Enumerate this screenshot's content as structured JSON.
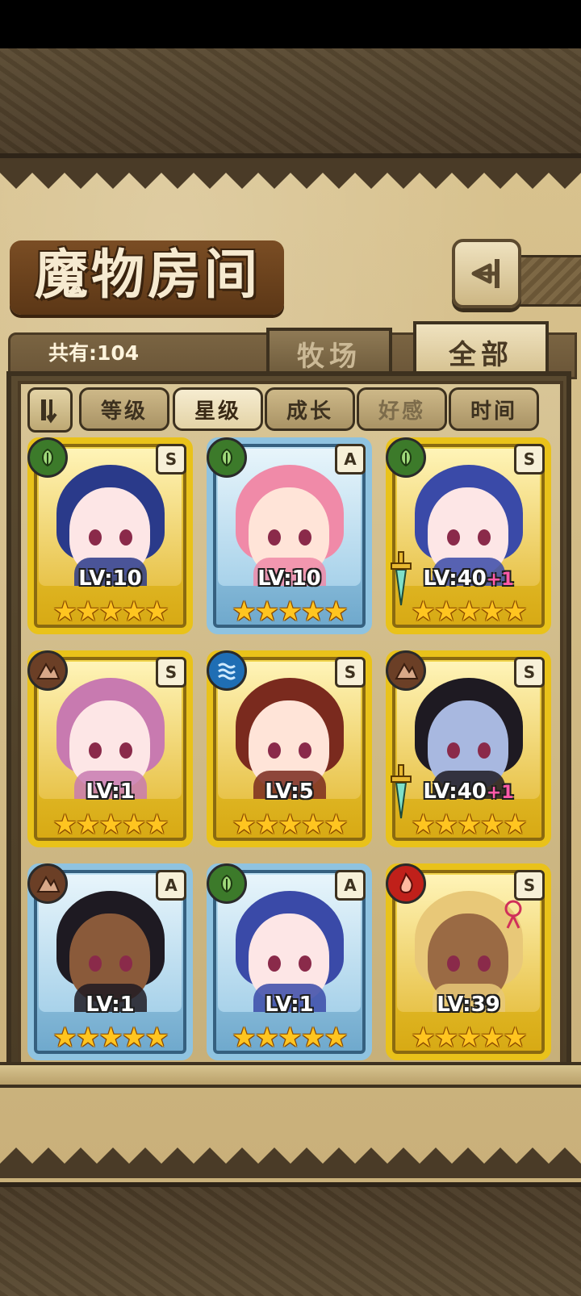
{
  "header": {
    "title": "魔物房间",
    "back_icon": "back-arrow-icon"
  },
  "count": {
    "label": "共有:104"
  },
  "tabs": [
    {
      "label": "牧场",
      "active": false
    },
    {
      "label": "全部",
      "active": true
    }
  ],
  "sort": {
    "toggle_icon": "sort-order-icon",
    "buttons": [
      {
        "label": "等级",
        "state": "normal"
      },
      {
        "label": "星级",
        "state": "active"
      },
      {
        "label": "成长",
        "state": "normal"
      },
      {
        "label": "好感",
        "state": "dim"
      },
      {
        "label": "时间",
        "state": "normal"
      }
    ]
  },
  "monsters": [
    {
      "rank": "S",
      "element": "grass",
      "level": "LV:10",
      "plus": "",
      "stars": 5,
      "frame": "gold"
    },
    {
      "rank": "A",
      "element": "grass",
      "level": "LV:10",
      "plus": "",
      "stars": 5,
      "frame": "blue"
    },
    {
      "rank": "S",
      "element": "grass",
      "level": "LV:40",
      "plus": "+1",
      "stars": 5,
      "frame": "gold"
    },
    {
      "rank": "S",
      "element": "rock",
      "level": "LV:1",
      "plus": "",
      "stars": 5,
      "frame": "gold"
    },
    {
      "rank": "S",
      "element": "water",
      "level": "LV:5",
      "plus": "",
      "stars": 5,
      "frame": "gold"
    },
    {
      "rank": "S",
      "element": "rock",
      "level": "LV:40",
      "plus": "+1",
      "stars": 5,
      "frame": "gold"
    },
    {
      "rank": "A",
      "element": "rock",
      "level": "LV:1",
      "plus": "",
      "stars": 5,
      "frame": "blue"
    },
    {
      "rank": "A",
      "element": "grass",
      "level": "LV:1",
      "plus": "",
      "stars": 5,
      "frame": "blue"
    },
    {
      "rank": "S",
      "element": "fire",
      "level": "LV:39",
      "plus": "",
      "stars": 5,
      "frame": "gold"
    }
  ],
  "colors": {
    "parchment": "#d8c28e",
    "gold_frame": "#e9c21a",
    "blue_frame": "#8fc3e0",
    "star": "#ffc520",
    "plus_level": "#ff5aa8"
  }
}
